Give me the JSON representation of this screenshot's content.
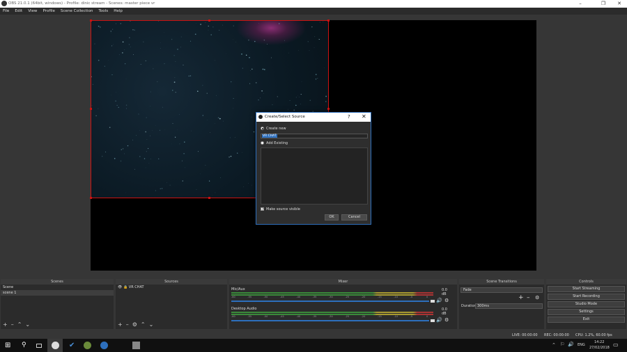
{
  "window": {
    "title": "OBS 21.0.1 (64bit, windows) - Profile: dinic stream - Scenes: master piece vr"
  },
  "menu": [
    "File",
    "Edit",
    "View",
    "Profile",
    "Scene Collection",
    "Tools",
    "Help"
  ],
  "dialog": {
    "title": "Create/Select Source",
    "help": "?",
    "close": "✕",
    "create_new_label": "Create new",
    "name_value": "VR CHAT",
    "add_existing_label": "Add Existing",
    "make_visible_label": "Make source visible",
    "ok_label": "OK",
    "cancel_label": "Cancel"
  },
  "docks": {
    "scenes": {
      "header": "Scenes",
      "items": [
        "Scene",
        "scene 1"
      ]
    },
    "sources": {
      "header": "Sources",
      "items": [
        "VR CHAT"
      ]
    },
    "mixer": {
      "header": "Mixer",
      "channels": [
        {
          "name": "Mic/Aux",
          "db": "0.0 dB"
        },
        {
          "name": "Desktop Audio",
          "db": "0.0 dB"
        }
      ],
      "scale": [
        "-60",
        "-55",
        "-50",
        "-45",
        "-40",
        "-35",
        "-30",
        "-25",
        "-20",
        "-15",
        "-10",
        "-5",
        "0"
      ]
    },
    "transitions": {
      "header": "Scene Transitions",
      "selected": "Fade",
      "duration_label": "Duration",
      "duration_value": "300ms"
    },
    "controls": {
      "header": "Controls",
      "buttons": [
        "Start Streaming",
        "Start Recording",
        "Studio Mode",
        "Settings",
        "Exit"
      ]
    }
  },
  "status": {
    "live": "LIVE: 00:00:00",
    "rec": "REC: 00:00:00",
    "cpu": "CPU: 1.2%, 60.00 fps"
  },
  "taskbar": {
    "lang": "ENG",
    "time": "14:22",
    "date": "27/02/2018"
  }
}
